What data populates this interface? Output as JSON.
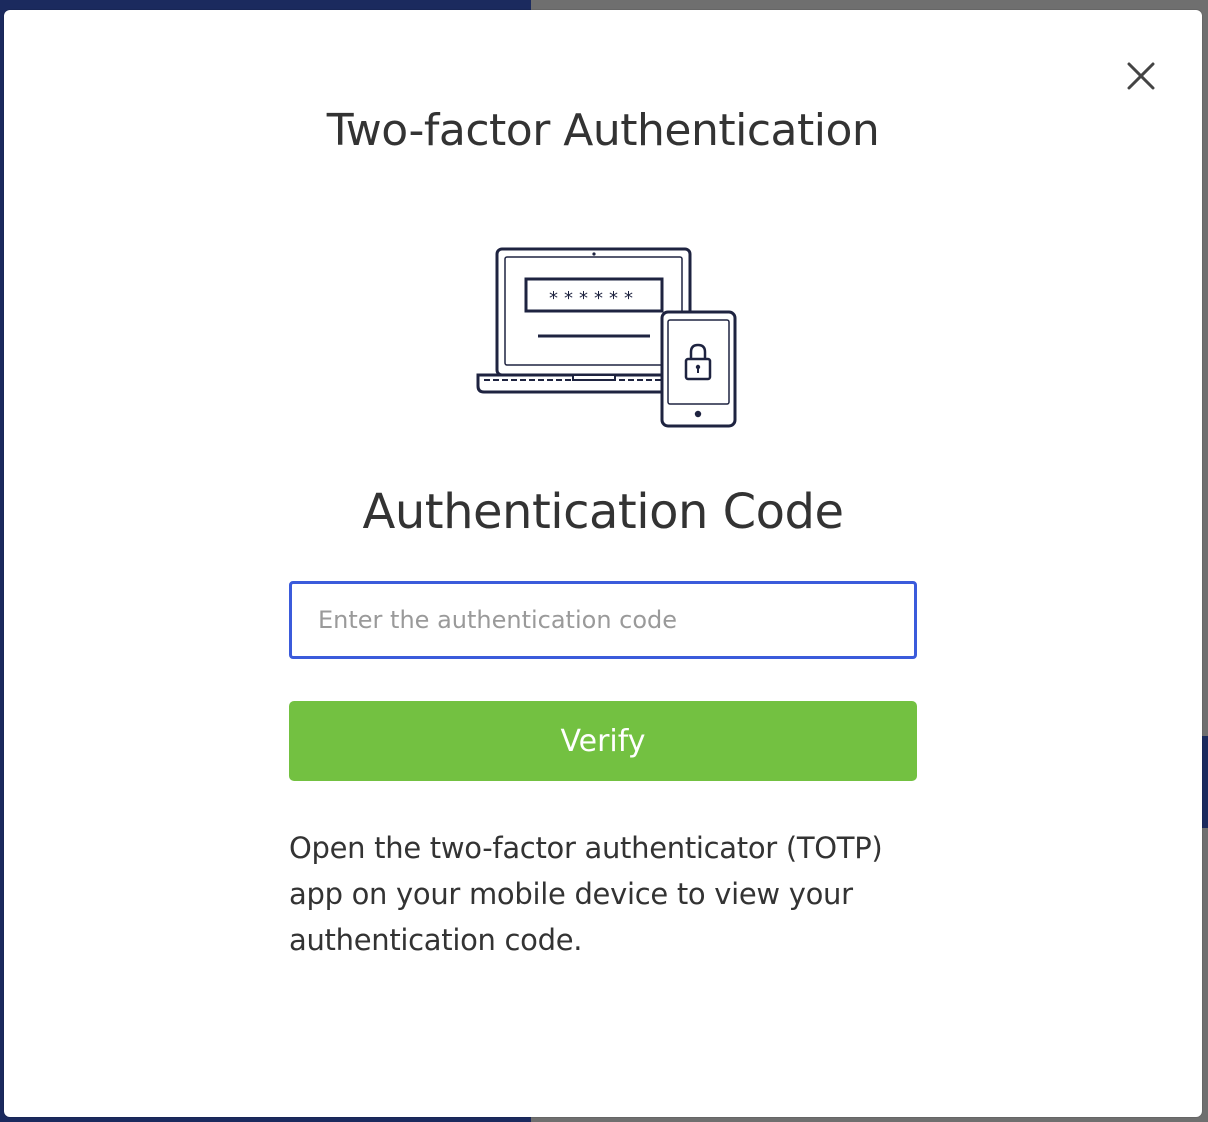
{
  "modal": {
    "title": "Two-factor Authentication",
    "subtitle": "Authentication Code",
    "close_icon": "close-icon",
    "illustration_icon": "laptop-phone-lock-icon",
    "password_mask": "******"
  },
  "code_field": {
    "placeholder": "Enter the authentication code",
    "value": ""
  },
  "verify_button": {
    "label": "Verify"
  },
  "help": {
    "text": "Open the two-factor authenticator (TOTP) app on your mobile device to view your authentication code."
  },
  "colors": {
    "accent_green": "#73c141",
    "focus_blue": "#3b5bdb",
    "text_dark": "#333333",
    "backdrop_navy": "#1b2a5e"
  }
}
